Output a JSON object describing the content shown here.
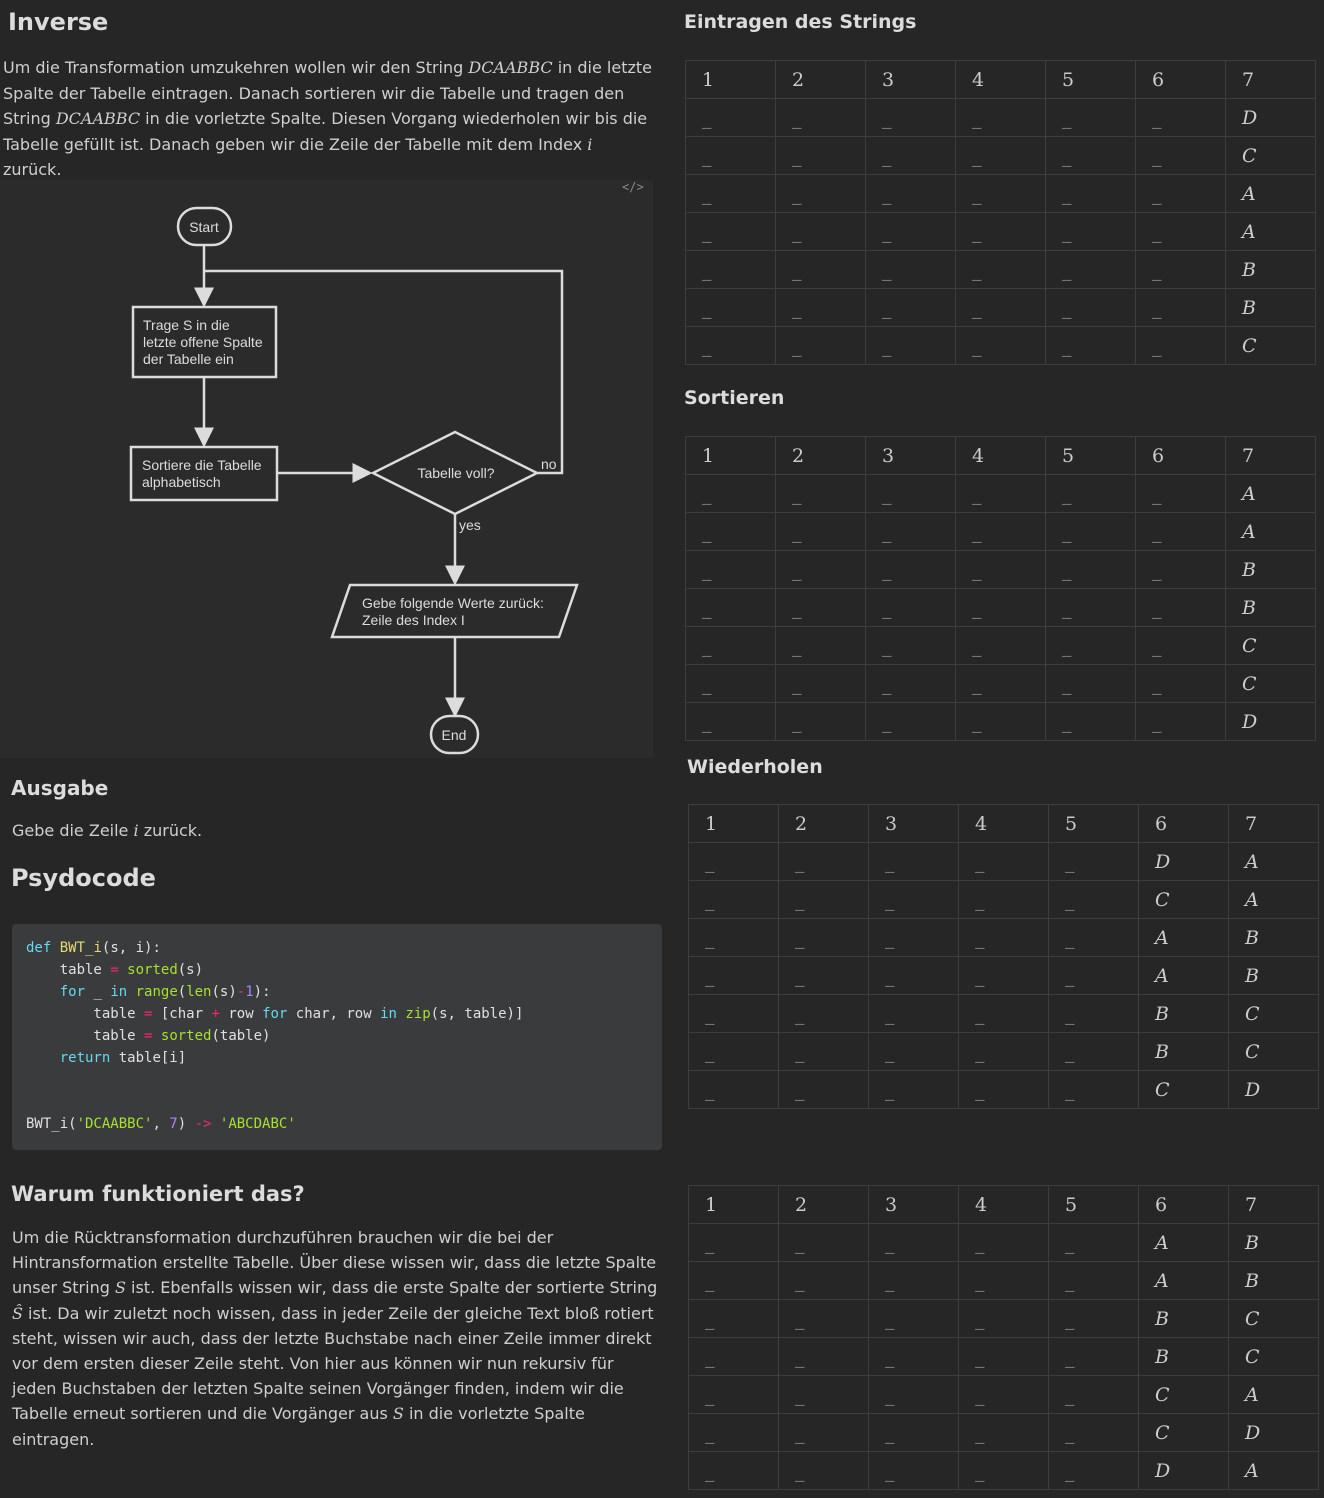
{
  "left": {
    "title_inverse": "Inverse",
    "intro_p1": "Um die Transformation umzukehren wollen wir den String ",
    "intro_math1": "DCAABBC",
    "intro_p2": " in die letzte Spalte der Tabelle eintragen. Danach sortieren wir die Tabelle und tragen den String ",
    "intro_math2": "DCAABBC",
    "intro_p3": " in die vorletzte Spalte. Diesen Vorgang wiederholen wir bis die Tabelle gefüllt ist. Danach geben wir die Zeile der Tabelle mit dem Index ",
    "intro_math3": "i",
    "intro_p4": " zurück.",
    "flowchart": {
      "start": "Start",
      "step1_line1": "Trage S in die",
      "step1_line2": "letzte offene Spalte",
      "step1_line3": "der Tabelle ein",
      "step2_line1": "Sortiere die Tabelle",
      "step2_line2": "alphabetisch",
      "decision": "Tabelle voll?",
      "no_label": "no",
      "yes_label": "yes",
      "output_line1": "Gebe folgende Werte zurück:",
      "output_line2": "Zeile des Index I",
      "end": "End",
      "code_toggle": "</>"
    },
    "title_ausgabe": "Ausgabe",
    "ausgabe_p1": "Gebe die Zeile ",
    "ausgabe_math": "i",
    "ausgabe_p2": " zurück.",
    "title_psydocode": "Psydocode",
    "title_warum": "Warum funktioniert das?",
    "warum_p1": "Um die Rücktransformation durchzuführen brauchen wir die bei der Hintransformation erstellte Tabelle. Über diese wissen wir, dass die letzte Spalte unser String ",
    "warum_math1": "S",
    "warum_p2": " ist. Ebenfalls wissen wir, dass die erste Spalte der sortierte String ",
    "warum_math2": "Ŝ",
    "warum_p3": " ist. Da wir zuletzt noch wissen, dass in jeder Zeile der gleiche Text bloß rotiert steht, wissen wir auch, dass der letzte Buchstabe nach einer Zeile immer direkt vor dem ersten dieser Zeile steht. Von hier aus können wir nun rekursiv für jeden Buchstaben der letzten Spalte seinen Vorgänger finden, indem wir die Tabelle erneut sortieren und die Vorgänger aus ",
    "warum_math3": "S",
    "warum_p4": " in die vorletzte Spalte eintragen."
  },
  "right": {
    "title_eintragen": "Eintragen des Strings",
    "title_sortieren": "Sortieren",
    "title_wiederholen": "Wiederholen",
    "headers": [
      "1",
      "2",
      "3",
      "4",
      "5",
      "6",
      "7"
    ],
    "blank": "_",
    "table_eintragen": [
      [
        "_",
        "_",
        "_",
        "_",
        "_",
        "_",
        "D"
      ],
      [
        "_",
        "_",
        "_",
        "_",
        "_",
        "_",
        "C"
      ],
      [
        "_",
        "_",
        "_",
        "_",
        "_",
        "_",
        "A"
      ],
      [
        "_",
        "_",
        "_",
        "_",
        "_",
        "_",
        "A"
      ],
      [
        "_",
        "_",
        "_",
        "_",
        "_",
        "_",
        "B"
      ],
      [
        "_",
        "_",
        "_",
        "_",
        "_",
        "_",
        "B"
      ],
      [
        "_",
        "_",
        "_",
        "_",
        "_",
        "_",
        "C"
      ]
    ],
    "table_sortieren": [
      [
        "_",
        "_",
        "_",
        "_",
        "_",
        "_",
        "A"
      ],
      [
        "_",
        "_",
        "_",
        "_",
        "_",
        "_",
        "A"
      ],
      [
        "_",
        "_",
        "_",
        "_",
        "_",
        "_",
        "B"
      ],
      [
        "_",
        "_",
        "_",
        "_",
        "_",
        "_",
        "B"
      ],
      [
        "_",
        "_",
        "_",
        "_",
        "_",
        "_",
        "C"
      ],
      [
        "_",
        "_",
        "_",
        "_",
        "_",
        "_",
        "C"
      ],
      [
        "_",
        "_",
        "_",
        "_",
        "_",
        "_",
        "D"
      ]
    ],
    "table_wiederholen": [
      [
        "_",
        "_",
        "_",
        "_",
        "_",
        "D",
        "A"
      ],
      [
        "_",
        "_",
        "_",
        "_",
        "_",
        "C",
        "A"
      ],
      [
        "_",
        "_",
        "_",
        "_",
        "_",
        "A",
        "B"
      ],
      [
        "_",
        "_",
        "_",
        "_",
        "_",
        "A",
        "B"
      ],
      [
        "_",
        "_",
        "_",
        "_",
        "_",
        "B",
        "C"
      ],
      [
        "_",
        "_",
        "_",
        "_",
        "_",
        "B",
        "C"
      ],
      [
        "_",
        "_",
        "_",
        "_",
        "_",
        "C",
        "D"
      ]
    ],
    "table_wiederholen_sorted": [
      [
        "_",
        "_",
        "_",
        "_",
        "_",
        "A",
        "B"
      ],
      [
        "_",
        "_",
        "_",
        "_",
        "_",
        "A",
        "B"
      ],
      [
        "_",
        "_",
        "_",
        "_",
        "_",
        "B",
        "C"
      ],
      [
        "_",
        "_",
        "_",
        "_",
        "_",
        "B",
        "C"
      ],
      [
        "_",
        "_",
        "_",
        "_",
        "_",
        "C",
        "A"
      ],
      [
        "_",
        "_",
        "_",
        "_",
        "_",
        "C",
        "D"
      ],
      [
        "_",
        "_",
        "_",
        "_",
        "_",
        "D",
        "A"
      ]
    ]
  }
}
